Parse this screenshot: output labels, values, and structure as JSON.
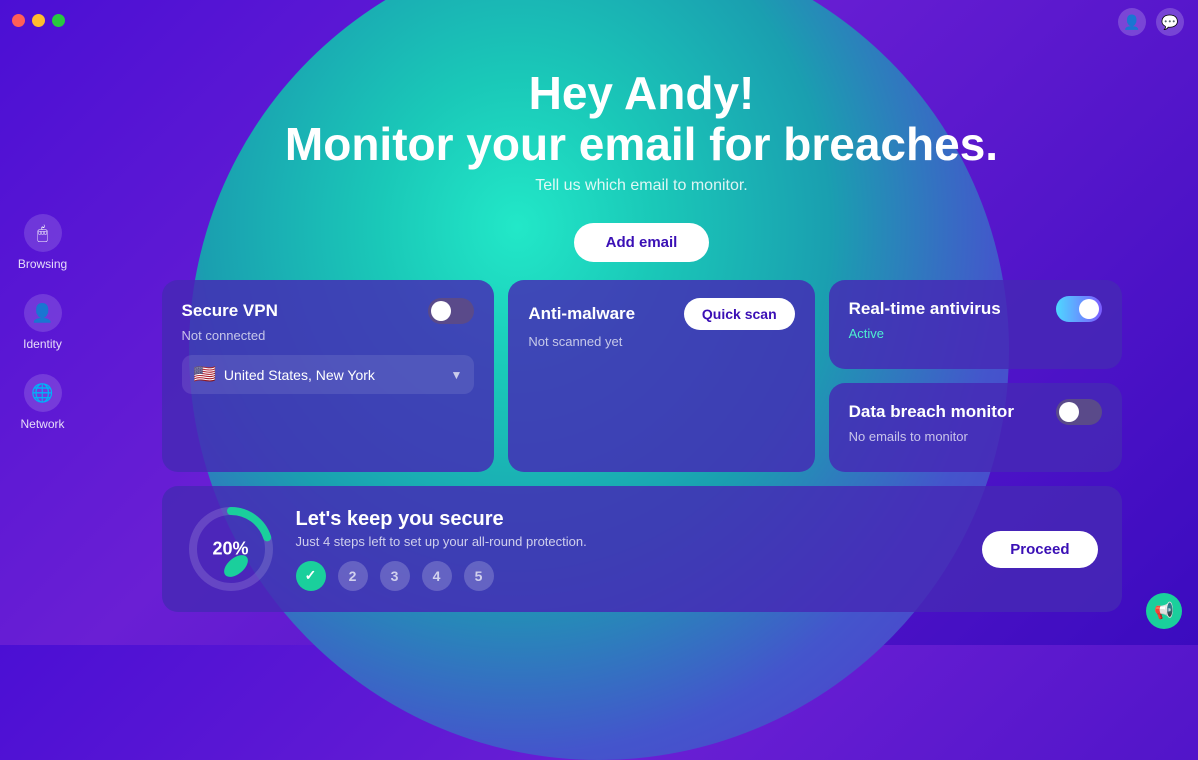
{
  "titlebar": {
    "traffic_lights": [
      "red",
      "yellow",
      "green"
    ],
    "right_icons": [
      "user",
      "chat"
    ]
  },
  "sidebar": {
    "items": [
      {
        "id": "browsing",
        "label": "Browsing",
        "icon": "🖱"
      },
      {
        "id": "identity",
        "label": "Identity",
        "icon": "👤"
      },
      {
        "id": "network",
        "label": "Network",
        "icon": "🌐"
      }
    ]
  },
  "hero": {
    "title": "Hey Andy!",
    "title2": "Monitor your email for breaches.",
    "subtitle": "Tell us which email to monitor.",
    "add_email_label": "Add email"
  },
  "vpn_card": {
    "title": "Secure VPN",
    "status": "Not connected",
    "toggle_state": "off",
    "location": "United States, New York",
    "flag": "🇺🇸"
  },
  "malware_card": {
    "title": "Anti-malware",
    "status": "Not scanned yet",
    "quick_scan_label": "Quick scan"
  },
  "antivirus_card": {
    "title": "Real-time antivirus",
    "status": "Active",
    "toggle_state": "on"
  },
  "breach_card": {
    "title": "Data breach monitor",
    "status": "No emails to monitor",
    "toggle_state": "off"
  },
  "setup_card": {
    "title": "Let's keep you secure",
    "desc": "Just 4 steps left to set up your all-round protection.",
    "progress_pct": "20%",
    "progress_value": 20,
    "steps": [
      {
        "label": "✓",
        "done": true
      },
      {
        "label": "2",
        "done": false
      },
      {
        "label": "3",
        "done": false
      },
      {
        "label": "4",
        "done": false
      },
      {
        "label": "5",
        "done": false
      }
    ],
    "proceed_label": "Proceed"
  },
  "bottom_icon": "📢"
}
